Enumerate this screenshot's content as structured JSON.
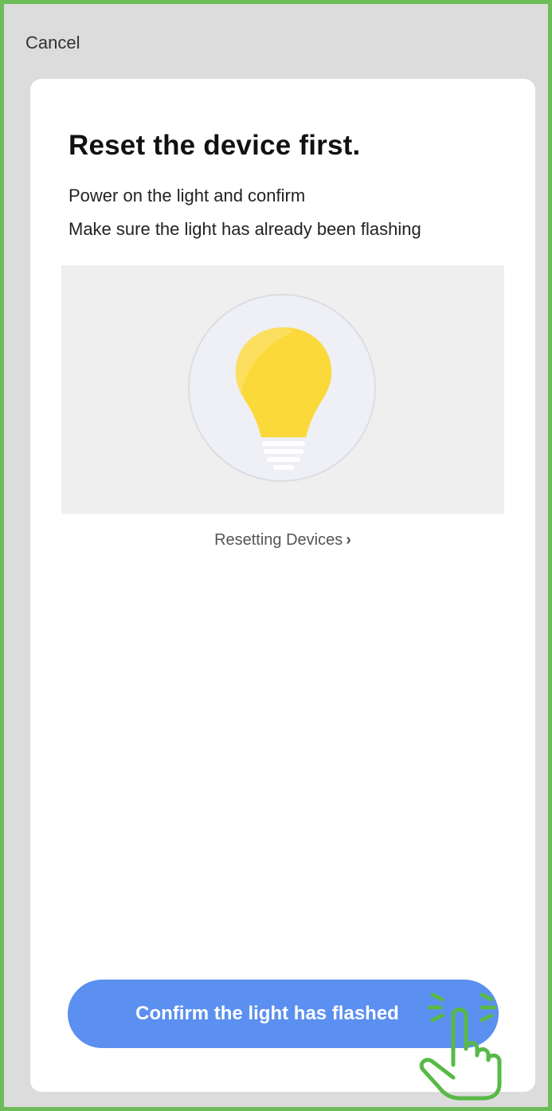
{
  "header": {
    "cancel_label": "Cancel"
  },
  "main": {
    "title": "Reset the device first.",
    "instructions": [
      "Power on the light and confirm",
      "Make sure the light has already been flashing"
    ],
    "illustration_icon": "lightbulb-icon",
    "reset_link_label": "Resetting Devices",
    "reset_link_chevron": "›"
  },
  "footer": {
    "confirm_label": "Confirm the light has flashed",
    "tap_hint_icon": "tap-hand-icon"
  },
  "colors": {
    "frame_border": "#6cbc57",
    "primary_button": "#5b8ff0",
    "bulb_yellow": "#fcd93a",
    "background": "#dcdcdc"
  }
}
